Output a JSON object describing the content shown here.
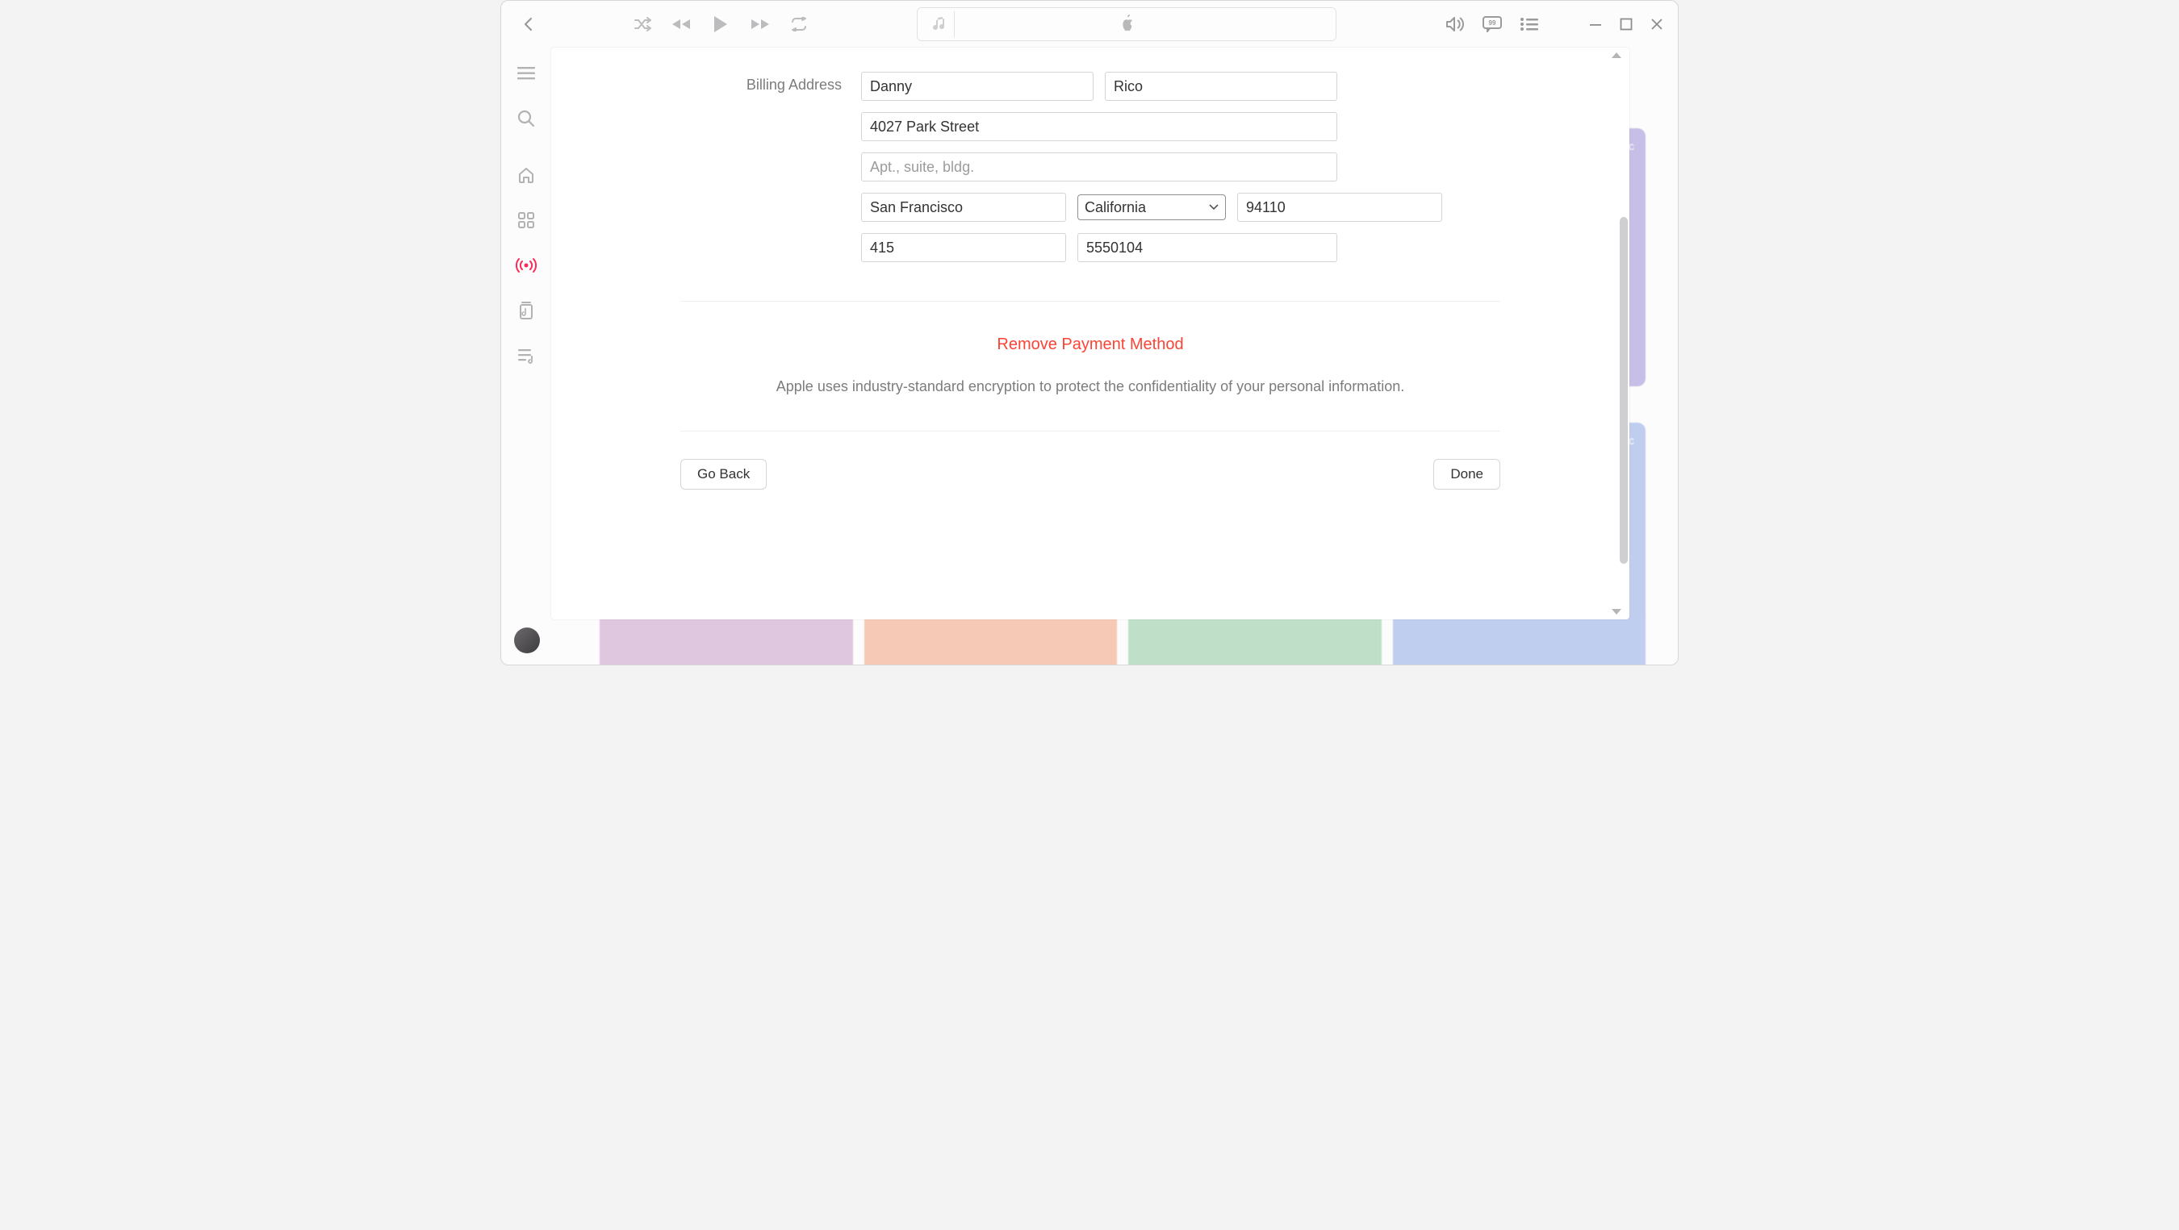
{
  "billing": {
    "section_label": "Billing Address",
    "first_name": "Danny",
    "last_name": "Rico",
    "street": "4027 Park Street",
    "apt_placeholder": "Apt., suite, bldg.",
    "apt": "",
    "city": "San Francisco",
    "state": "California",
    "zip": "94110",
    "phone_area": "415",
    "phone_number": "5550104"
  },
  "actions": {
    "remove_label": "Remove Payment Method",
    "encryption_note": "Apple uses industry-standard encryption to protect the confidentiality of your personal information.",
    "go_back": "Go Back",
    "done": "Done"
  },
  "bg": {
    "card_label": "ic"
  }
}
